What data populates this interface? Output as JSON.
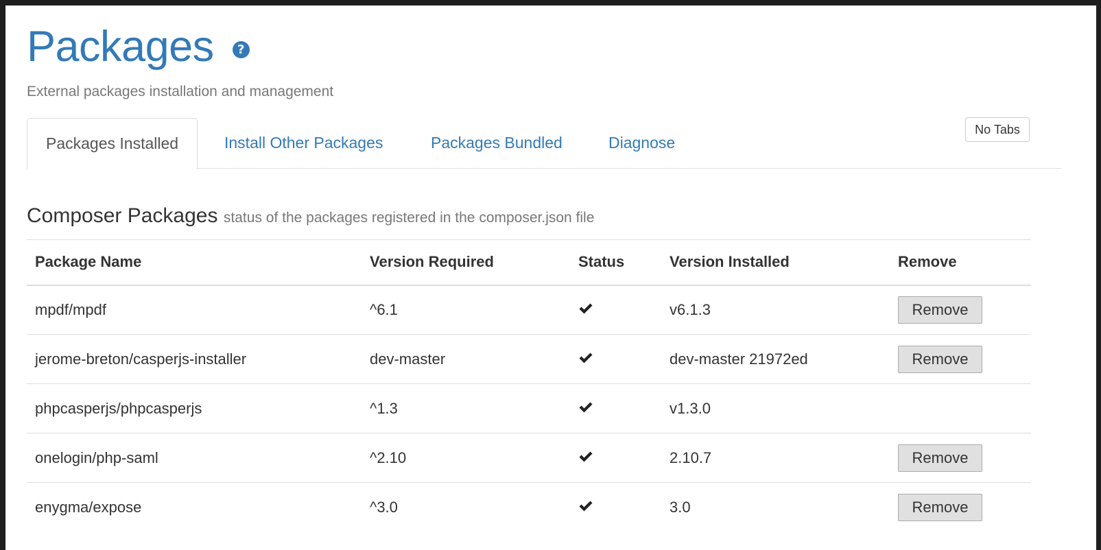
{
  "header": {
    "title": "Packages",
    "help_icon": "question-circle-icon",
    "subtitle": "External packages installation and management"
  },
  "tabs": [
    {
      "label": "Packages Installed",
      "active": true
    },
    {
      "label": "Install Other Packages",
      "active": false
    },
    {
      "label": "Packages Bundled",
      "active": false
    },
    {
      "label": "Diagnose",
      "active": false
    }
  ],
  "no_tabs_label": "No Tabs",
  "section": {
    "title": "Composer Packages",
    "description": "status of the packages registered in the composer.json file"
  },
  "table": {
    "columns": [
      "Package Name",
      "Version Required",
      "Status",
      "Version Installed",
      "Remove"
    ],
    "rows": [
      {
        "name": "mpdf/mpdf",
        "required": "^6.1",
        "status": "check-icon",
        "installed": "v6.1.3",
        "remove": "Remove"
      },
      {
        "name": "jerome-breton/casperjs-installer",
        "required": "dev-master",
        "status": "check-icon",
        "installed": "dev-master 21972ed",
        "remove": "Remove"
      },
      {
        "name": "phpcasperjs/phpcasperjs",
        "required": "^1.3",
        "status": "check-icon",
        "installed": "v1.3.0",
        "remove": ""
      },
      {
        "name": "onelogin/php-saml",
        "required": "^2.10",
        "status": "check-icon",
        "installed": "2.10.7",
        "remove": "Remove"
      },
      {
        "name": "enygma/expose",
        "required": "^3.0",
        "status": "check-icon",
        "installed": "3.0",
        "remove": "Remove"
      }
    ]
  },
  "colors": {
    "link": "#337ab7",
    "text": "#333333",
    "muted": "#777777",
    "border": "#dddddd"
  }
}
